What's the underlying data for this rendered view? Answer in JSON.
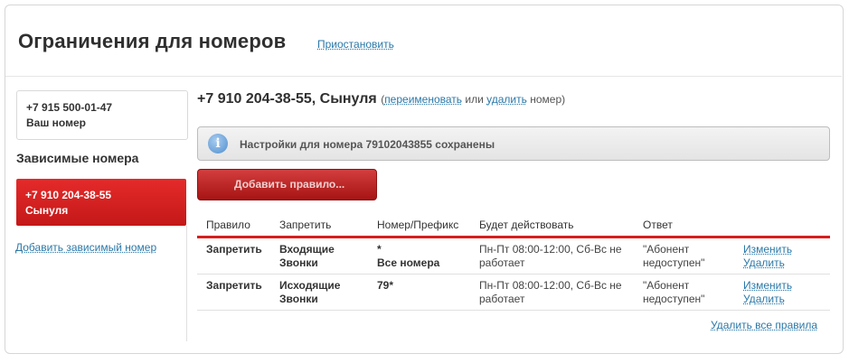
{
  "header": {
    "title": "Ограничения для номеров",
    "pause_link": "Приостановить"
  },
  "sidebar": {
    "own_number": "+7 915 500-01-47",
    "own_label": "Ваш номер",
    "dependent_heading": "Зависимые номера",
    "dependent_active": {
      "number": "+7 910 204-38-55",
      "name": "Сынуля"
    },
    "add_dependent": "Добавить зависимый номер"
  },
  "main": {
    "title": "+7 910 204-38-55, Сынуля",
    "paren_open": "(",
    "rename_link": "переименовать",
    "or_text": "или",
    "delete_link": "удалить",
    "number_text": "номер)",
    "notice": "Настройки для номера 79102043855 сохранены",
    "add_rule_button": "Добавить правило...",
    "table": {
      "headers": [
        "Правило",
        "Запретить",
        "Номер/Префикс",
        "Будет действовать",
        "Ответ"
      ],
      "rows": [
        {
          "rule": "Запретить",
          "block_1": "Входящие",
          "block_2": "Звонки",
          "prefix_1": "*",
          "prefix_2": "Все номера",
          "schedule_1": "Пн-Пт 08:00-12:00, Сб-Вс не",
          "schedule_2": "работает",
          "answer_1": "\"Абонент",
          "answer_2": "недоступен\"",
          "edit": "Изменить",
          "delete": "Удалить"
        },
        {
          "rule": "Запретить",
          "block_1": "Исходящие",
          "block_2": "Звонки",
          "prefix_1": "79*",
          "prefix_2": "",
          "schedule_1": "Пн-Пт 08:00-12:00, Сб-Вс не",
          "schedule_2": "работает",
          "answer_1": "\"Абонент",
          "answer_2": "недоступен\"",
          "edit": "Изменить",
          "delete": "Удалить"
        }
      ]
    },
    "delete_all": "Удалить все правила"
  },
  "icons": {
    "notice_icon": "info-icon"
  },
  "colors": {
    "accent_red": "#d61e1e",
    "link_blue": "#2a78a8"
  }
}
